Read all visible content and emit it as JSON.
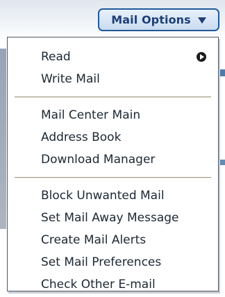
{
  "button": {
    "label": "Mail Options",
    "icon": "chevron-down-icon"
  },
  "menu": {
    "sections": [
      {
        "items": [
          {
            "label": "Read",
            "has_submenu": true,
            "submenu_icon": "submenu-arrow-icon"
          },
          {
            "label": "Write Mail"
          }
        ]
      },
      {
        "items": [
          {
            "label": "Mail Center Main"
          },
          {
            "label": "Address Book"
          },
          {
            "label": "Download Manager"
          }
        ]
      },
      {
        "items": [
          {
            "label": "Block Unwanted Mail"
          },
          {
            "label": "Set Mail Away Message"
          },
          {
            "label": "Create Mail Alerts"
          },
          {
            "label": "Set Mail Preferences"
          },
          {
            "label": "Check Other E-mail"
          }
        ]
      }
    ]
  },
  "colors": {
    "button_border": "#1f5a9b",
    "button_text": "#1c3f76",
    "menu_text": "#1c2732",
    "menu_border": "#4e5763"
  }
}
